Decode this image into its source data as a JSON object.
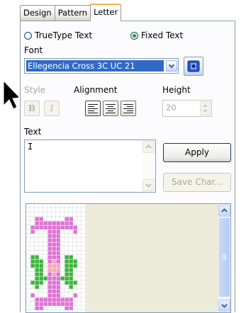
{
  "tabs": [
    "Design",
    "Pattern",
    "Letter"
  ],
  "active_tab": "Letter",
  "text_type": {
    "options": [
      "TrueType Text",
      "Fixed Text"
    ],
    "selected": "Fixed Text"
  },
  "font": {
    "label": "Font",
    "value": "Ellegencia Cross 3C UC 21"
  },
  "style": {
    "label": "Style",
    "bold": "B",
    "italic": "I"
  },
  "alignment": {
    "label": "Alignment",
    "options": [
      "left",
      "center",
      "right"
    ]
  },
  "height": {
    "label": "Height",
    "value": "20"
  },
  "text": {
    "label": "Text",
    "value": "I"
  },
  "buttons": {
    "apply": "Apply",
    "save_char": "Save Char..."
  },
  "colors": {
    "letter_pink": "#e070d8",
    "flower_green": "#39b539",
    "flower_center": "#f8a8b8"
  }
}
